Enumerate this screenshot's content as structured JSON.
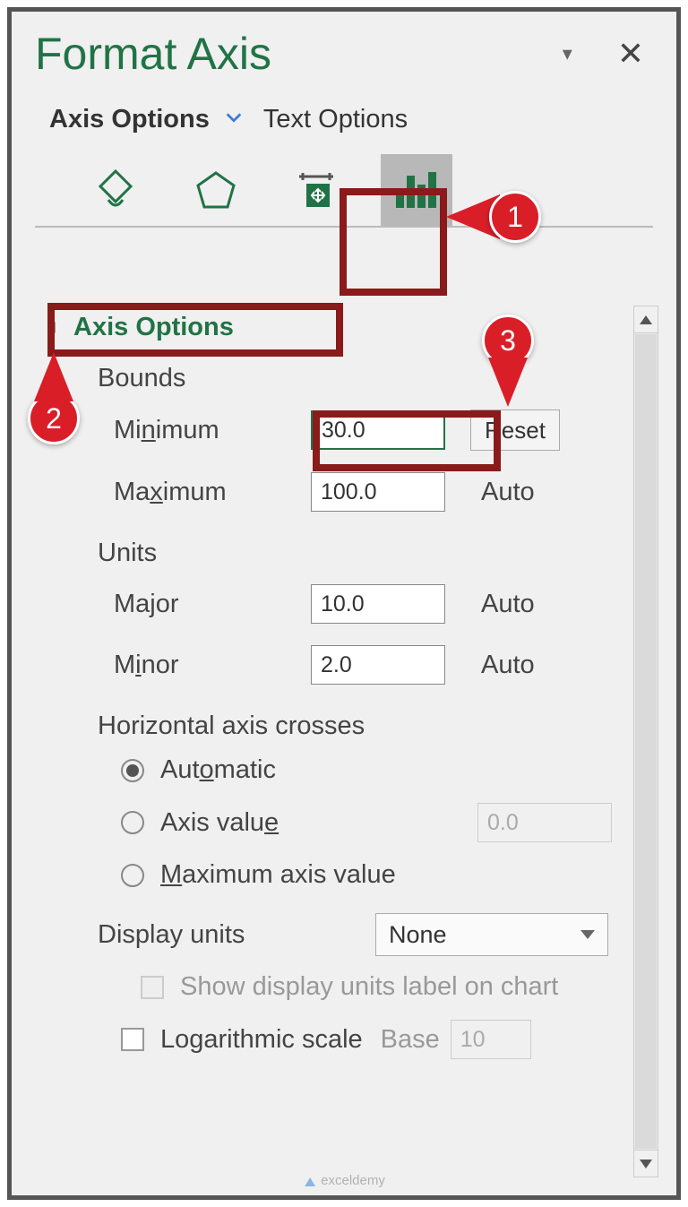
{
  "pane": {
    "title": "Format Axis",
    "tabs": {
      "options": "Axis Options",
      "text": "Text Options"
    },
    "section_title": "Axis Options",
    "bounds": {
      "label": "Bounds",
      "min_label_pre": "Mi",
      "min_label_ul": "n",
      "min_label_post": "imum",
      "min_value": "30.0",
      "reset": "Reset",
      "max_label_pre": "Ma",
      "max_label_ul": "x",
      "max_label_post": "imum",
      "max_value": "100.0",
      "auto": "Auto"
    },
    "units": {
      "label": "Units",
      "major_label_pre": "Ma",
      "major_label_ul": "j",
      "major_label_post": "or",
      "major_value": "10.0",
      "minor_label_pre": "M",
      "minor_label_ul": "i",
      "minor_label_post": "nor",
      "minor_value": "2.0",
      "auto": "Auto"
    },
    "hcross": {
      "label": "Horizontal axis crosses",
      "auto_pre": "Aut",
      "auto_ul": "o",
      "auto_post": "matic",
      "axisval_pre": "Axis valu",
      "axisval_ul": "e",
      "axisval_post": "",
      "axisval_value": "0.0",
      "maxval_pre": "",
      "maxval_ul": "M",
      "maxval_post": "aximum axis value"
    },
    "displayunits": {
      "label_pre": "Display ",
      "label_ul": "u",
      "label_post": "nits",
      "value": "None",
      "show_pre": "",
      "show_ul": "S",
      "show_post": "how display units label on chart"
    },
    "logscale": {
      "label_pre": "",
      "label_ul": "L",
      "label_post": "ogarithmic scale",
      "base_label_pre": "",
      "base_label_ul": "B",
      "base_label_post": "ase",
      "base_value": "10"
    }
  },
  "annotations": {
    "a1": "1",
    "a2": "2",
    "a3": "3"
  },
  "watermark": "exceldemy"
}
